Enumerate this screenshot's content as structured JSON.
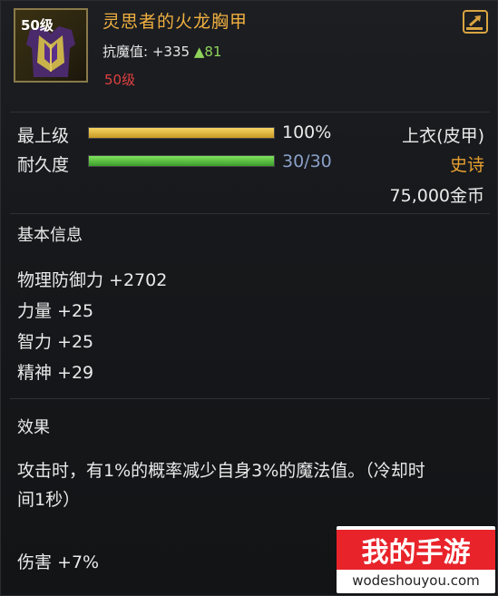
{
  "item": {
    "level_badge": "50级",
    "name": "灵思者的火龙胸甲",
    "main_stat_label": "抗魔值:",
    "main_stat_value": "+335",
    "main_stat_bonus": "▲81",
    "required_level": "50级"
  },
  "bars": {
    "upgrade": {
      "label": "最上级",
      "value_text": "100%",
      "fill": 1.0
    },
    "durability": {
      "label": "耐久度",
      "value_text": "30/30",
      "fill": 1.0
    }
  },
  "info": {
    "slot": "上衣(皮甲)",
    "rarity": "史诗",
    "price": "75,000金币"
  },
  "basic": {
    "title": "基本信息",
    "attrs": [
      "物理防御力 +2702",
      "力量 +25",
      "智力 +25",
      "精神 +29"
    ]
  },
  "effects": {
    "title": "效果",
    "line1": "攻击时，有1%的概率减少自身3%的魔法值。（冷却时",
    "line2": "间1秒）",
    "damage": "伤害 +7%"
  },
  "watermark": {
    "logo_text": "我的手游",
    "url": "wodeshouyou.com"
  },
  "colors": {
    "title": "#f0b040",
    "rarity": "#e8a030",
    "bonus": "#8fd35a",
    "required_level": "#e04040",
    "durability_value": "#8aa0c8"
  }
}
